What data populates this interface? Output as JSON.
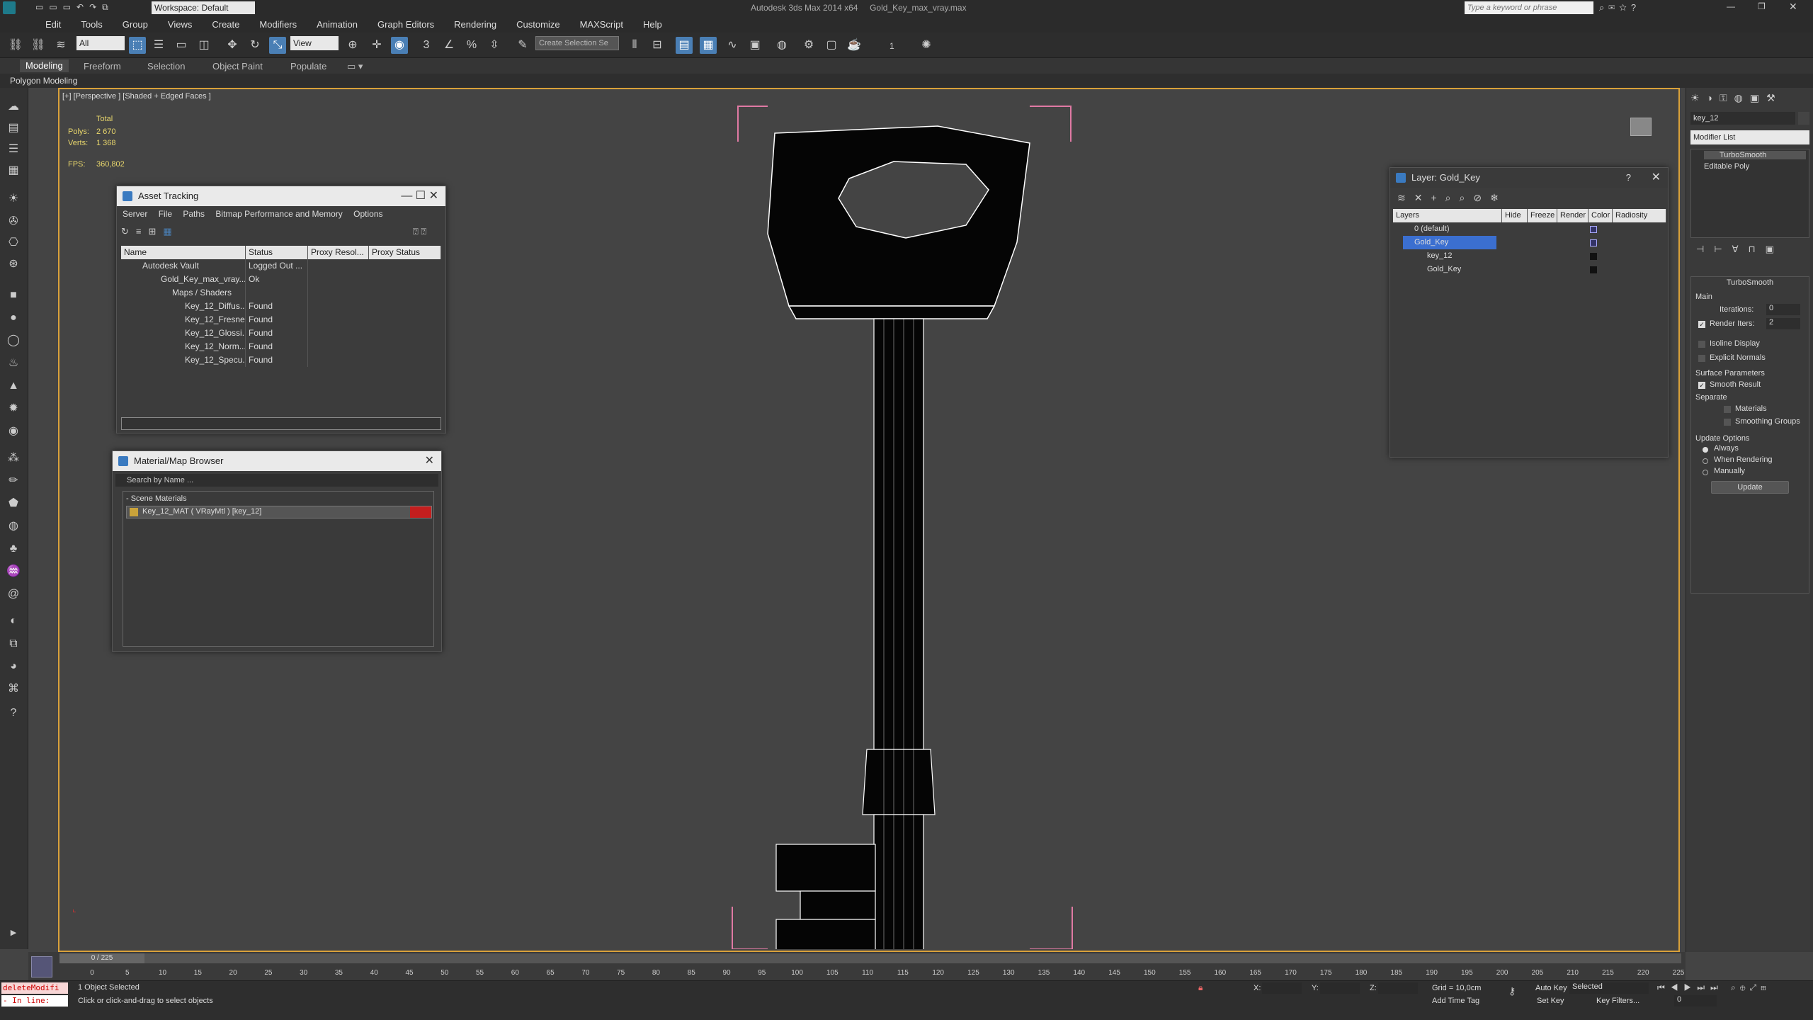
{
  "app": {
    "title": "Autodesk 3ds Max 2014 x64     Gold_Key_max_vray.max",
    "workspace": "Workspace: Default",
    "search_placeholder": "Type a keyword or phrase"
  },
  "menu": [
    "Edit",
    "Tools",
    "Group",
    "Views",
    "Create",
    "Modifiers",
    "Animation",
    "Graph Editors",
    "Rendering",
    "Customize",
    "MAXScript",
    "Help"
  ],
  "toolbar": {
    "filter": "All",
    "refcoord": "View",
    "named_sel": "Create Selection Se",
    "spinner_val": "1"
  },
  "ribbon": {
    "tabs": [
      "Modeling",
      "Freeform",
      "Selection",
      "Object Paint",
      "Populate"
    ],
    "sub": "Polygon Modeling"
  },
  "viewport": {
    "label": "[+] [Perspective ] [Shaded + Edged Faces ]",
    "stats_total": "Total",
    "polys_label": "Polys:",
    "polys": "2 670",
    "verts_label": "Verts:",
    "verts": "1 368",
    "fps_label": "FPS:",
    "fps": "360,802"
  },
  "asset_tracking": {
    "title": "Asset Tracking",
    "menu": [
      "Server",
      "File",
      "Paths",
      "Bitmap Performance and Memory",
      "Options"
    ],
    "columns": [
      "Name",
      "Status",
      "Proxy Resol...",
      "Proxy Status"
    ],
    "rows": [
      {
        "name": "Autodesk Vault",
        "status": "Logged Out ..."
      },
      {
        "name": "Gold_Key_max_vray....",
        "status": "Ok"
      },
      {
        "name": "Maps / Shaders",
        "status": ""
      },
      {
        "name": "Key_12_Diffus...",
        "status": "Found"
      },
      {
        "name": "Key_12_Fresne...",
        "status": "Found"
      },
      {
        "name": "Key_12_Glossi...",
        "status": "Found"
      },
      {
        "name": "Key_12_Norm...",
        "status": "Found"
      },
      {
        "name": "Key_12_Specu...",
        "status": "Found"
      }
    ]
  },
  "material_browser": {
    "title": "Material/Map Browser",
    "search": "Search by Name ...",
    "section": "- Scene Materials",
    "item": "Key_12_MAT ( VRayMtl ) [key_12]"
  },
  "layer_panel": {
    "title": "Layer: Gold_Key",
    "help": "?",
    "columns": [
      "Layers",
      "Hide",
      "Freeze",
      "Render",
      "Color",
      "Radiosity"
    ],
    "rows": [
      {
        "name": "0 (default)"
      },
      {
        "name": "Gold_Key"
      },
      {
        "name": "key_12"
      },
      {
        "name": "Gold_Key"
      }
    ]
  },
  "command_panel": {
    "object_name": "key_12",
    "modifier_list": "Modifier List",
    "stack": [
      "TurboSmooth",
      "Editable Poly"
    ],
    "rollout": "TurboSmooth",
    "main": "Main",
    "iterations_label": "Iterations:",
    "iterations": "0",
    "render_iters_label": "Render Iters:",
    "render_iters": "2",
    "isoline": "Isoline Display",
    "explicit": "Explicit Normals",
    "surface": "Surface Parameters",
    "smooth_result": "Smooth Result",
    "separate": "Separate",
    "materials": "Materials",
    "smoothing_groups": "Smoothing Groups",
    "update_options": "Update Options",
    "always": "Always",
    "when_rendering": "When Rendering",
    "manually": "Manually",
    "update_btn": "Update"
  },
  "timeline": {
    "frame": "0 / 225",
    "ticks": [
      "0",
      "5",
      "10",
      "15",
      "20",
      "25",
      "30",
      "35",
      "40",
      "45",
      "50",
      "55",
      "60",
      "65",
      "70",
      "75",
      "80",
      "85",
      "90",
      "95",
      "100",
      "105",
      "110",
      "115",
      "120",
      "125",
      "130",
      "135",
      "140",
      "145",
      "150",
      "155",
      "160",
      "165",
      "170",
      "175",
      "180",
      "185",
      "190",
      "195",
      "200",
      "205",
      "210",
      "215",
      "220",
      "225"
    ]
  },
  "status": {
    "script1": "deleteModifi",
    "script2": "- In line:",
    "selected": "1 Object Selected",
    "prompt": "Click or click-and-drag to select objects",
    "x_label": "X:",
    "y_label": "Y:",
    "z_label": "Z:",
    "grid": "Grid = 10,0cm",
    "add_time_tag": "Add Time Tag",
    "auto_key": "Auto Key",
    "selected_dd": "Selected",
    "set_key": "Set Key",
    "key_filters": "Key Filters...",
    "frame_field": "0"
  },
  "colors": {
    "accent": "#4a7fb5",
    "selection_border": "#d9a13a",
    "layer_sel": "#3b6fd0",
    "material_red": "#c41e1e"
  }
}
